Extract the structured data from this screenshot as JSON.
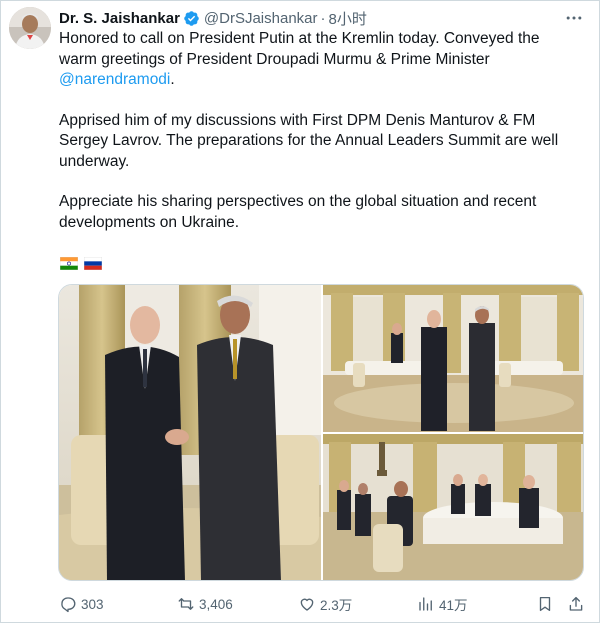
{
  "tweet": {
    "author": {
      "display_name": "Dr. S. Jaishankar",
      "handle": "@DrSJaishankar",
      "separator": "·",
      "time": "8小时",
      "verified": true,
      "verified_icon": "verified-badge-icon"
    },
    "paragraphs": {
      "p1_text": "Honored to call on President Putin at the Kremlin today. Conveyed the warm greetings of President Droupadi Murmu & Prime Minister",
      "p1_mention": "@narendramodi",
      "p1_end": ".",
      "p2": "Apprised him of my discussions with First DPM Denis Manturov & FM Sergey Lavrov. The preparations for the Annual Leaders Summit are well underway.",
      "p3": "Appreciate his sharing perspectives on the global situation and recent developments on Ukraine."
    },
    "flags": [
      "india-flag-icon",
      "russia-flag-icon"
    ],
    "media": {
      "photos": [
        "handshake-photo",
        "kremlin-hall-photo",
        "meeting-table-photo"
      ]
    },
    "actions": {
      "replies": "303",
      "reposts": "3,406",
      "likes": "2.3万",
      "views": "41万"
    }
  },
  "colors": {
    "link": "#1d9bf0",
    "text_primary": "#0f1419",
    "text_secondary": "#536471",
    "border": "#cfd9de",
    "verified": "#1d9bf0"
  }
}
